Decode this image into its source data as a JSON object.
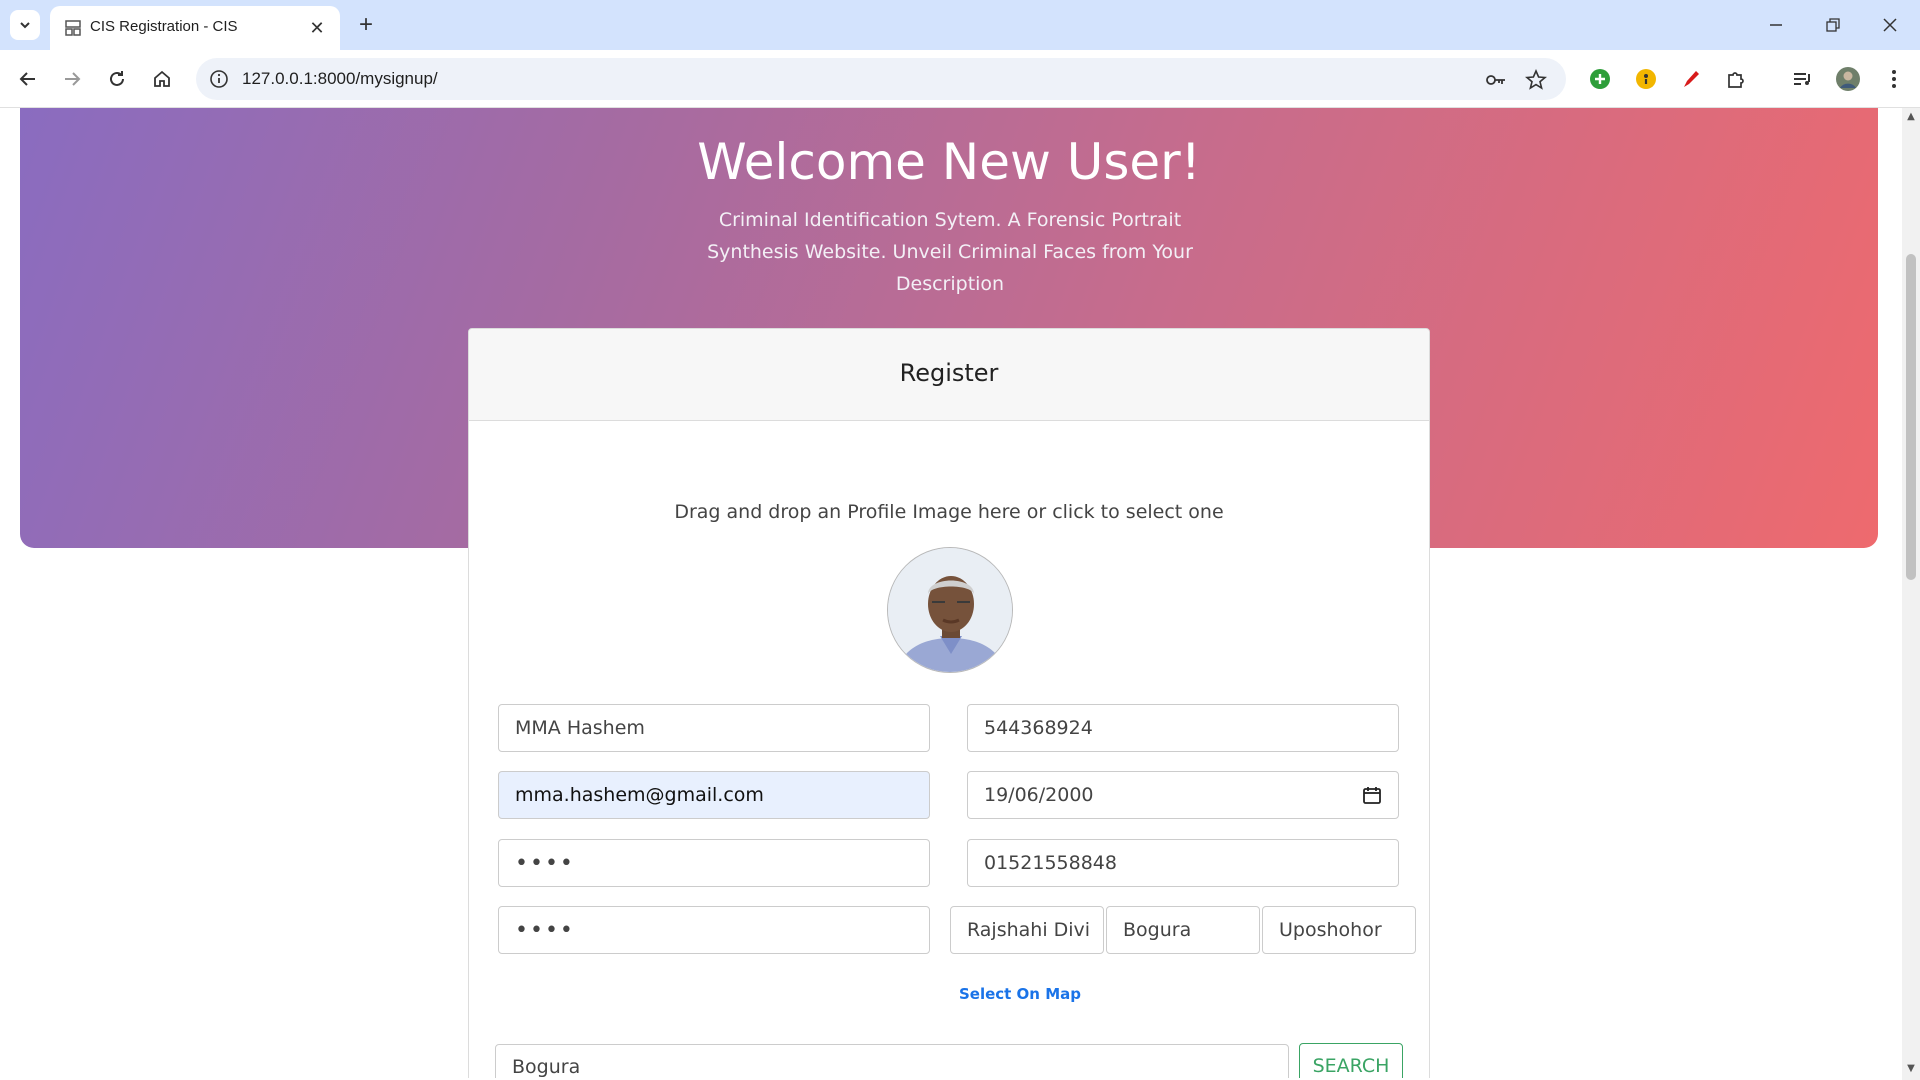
{
  "browser": {
    "tab_title": "CIS Registration - CIS",
    "url": "127.0.0.1:8000/mysignup/"
  },
  "hero": {
    "title": "Welcome New User!",
    "subtitle": "Criminal Identification Sytem. A Forensic Portrait Synthesis Website. Unveil Criminal Faces from Your Description"
  },
  "form": {
    "header": "Register",
    "dropzone_text": "Drag and drop an Profile Image here or click to select one",
    "name": "MMA Hashem",
    "nid": "544368924",
    "email": "mma.hashem@gmail.com",
    "dob": "19/06/2000",
    "password": "••••",
    "phone": "01521558848",
    "confirm_password": "••••",
    "division": "Rajshahi Divi",
    "district": "Bogura",
    "upazila": "Uposhohor",
    "map_link": "Select On Map",
    "search_value": "Bogura",
    "search_label": "SEARCH"
  }
}
